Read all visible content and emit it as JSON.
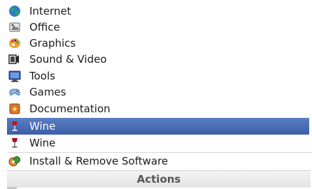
{
  "menu": {
    "items": [
      {
        "label": "Internet",
        "icon": "globe-icon"
      },
      {
        "label": "Office",
        "icon": "office-icon"
      },
      {
        "label": "Graphics",
        "icon": "graphics-palette-icon"
      },
      {
        "label": "Sound & Video",
        "icon": "sound-video-icon"
      },
      {
        "label": "Tools",
        "icon": "tools-monitor-icon"
      },
      {
        "label": "Games",
        "icon": "gamepad-icon"
      },
      {
        "label": "Documentation",
        "icon": "book-icon"
      },
      {
        "label": "Wine",
        "icon": "wine-glass-icon",
        "selected": true
      },
      {
        "label": "Wine",
        "icon": "wine-glass-icon"
      }
    ],
    "install": {
      "label": "Install & Remove Software",
      "icon": "install-software-icon"
    },
    "actions_header": "Actions"
  },
  "colors": {
    "selection": "#3b5fa7",
    "selection_text": "#ffffff",
    "header_text": "#555555"
  }
}
